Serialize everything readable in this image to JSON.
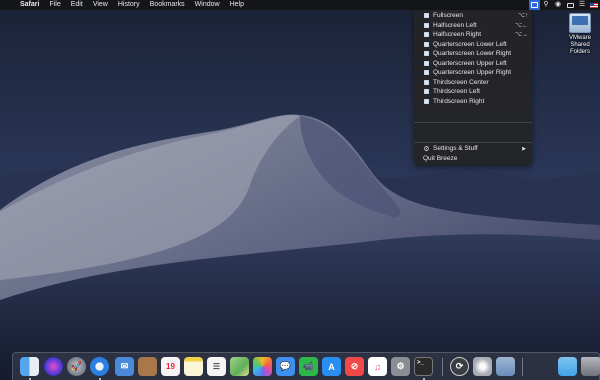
{
  "menubar": {
    "app_name": "Safari",
    "menus": [
      "File",
      "Edit",
      "View",
      "History",
      "Bookmarks",
      "Window",
      "Help"
    ]
  },
  "status_icons": [
    "breeze-icon",
    "search-icon",
    "siri-icon",
    "airplay-icon",
    "notification-center-icon",
    "flag-icon"
  ],
  "breeze_menu": {
    "items": [
      {
        "label": "Fullscreen",
        "shortcut": "⌥↑"
      },
      {
        "label": "Halfscreen Left",
        "shortcut": "⌥←"
      },
      {
        "label": "Halfscreen Right",
        "shortcut": "⌥→"
      },
      {
        "label": "Quarterscreen Lower Left",
        "shortcut": ""
      },
      {
        "label": "Quarterscreen Lower Right",
        "shortcut": ""
      },
      {
        "label": "Quarterscreen Upper Left",
        "shortcut": ""
      },
      {
        "label": "Quarterscreen Upper Right",
        "shortcut": ""
      },
      {
        "label": "Thirdscreen Center",
        "shortcut": ""
      },
      {
        "label": "Thirdscreen Left",
        "shortcut": ""
      },
      {
        "label": "Thirdscreen Right",
        "shortcut": ""
      }
    ],
    "settings_label": "Settings & Stuff",
    "quit_label": "Quit Breeze"
  },
  "desktop_icon": {
    "label_line1": "VMware Shared",
    "label_line2": "Folders"
  },
  "dock": {
    "apps": [
      {
        "name": "finder-icon",
        "color": "#3b8de0"
      },
      {
        "name": "siri-icon",
        "color": "#6a3fc8"
      },
      {
        "name": "launchpad-icon",
        "color": "#7d8790"
      },
      {
        "name": "safari-icon",
        "color": "#2a7fe0"
      },
      {
        "name": "mail-icon",
        "color": "#4a8ad8"
      },
      {
        "name": "contacts-icon",
        "color": "#a8784a"
      },
      {
        "name": "calendar-icon",
        "color": "#f4f4f4"
      },
      {
        "name": "notes-icon",
        "color": "#f3d14a"
      },
      {
        "name": "reminders-icon",
        "color": "#f5f5f5"
      },
      {
        "name": "maps-icon",
        "color": "#5fae5a"
      },
      {
        "name": "photos-icon",
        "color": "#f0f0f0"
      },
      {
        "name": "messages-icon",
        "color": "#3f8ff0"
      },
      {
        "name": "facetime-icon",
        "color": "#2fb84a"
      },
      {
        "name": "app-store-icon",
        "color": "#2a8ef0"
      },
      {
        "name": "news-icon",
        "color": "#f24848"
      },
      {
        "name": "music-icon",
        "color": "#f04a6a"
      },
      {
        "name": "system-preferences-icon",
        "color": "#8a8d94"
      },
      {
        "name": "terminal-icon",
        "color": "#2a2a2a"
      },
      {
        "name": "breeze-app-icon",
        "color": "#3a3d44"
      },
      {
        "name": "disk-utility-icon",
        "color": "#c9ccd2"
      },
      {
        "name": "preview-icon",
        "color": "#6a8cbc"
      },
      {
        "name": "downloads-folder-icon",
        "color": "#3fa3e6"
      },
      {
        "name": "trash-icon",
        "color": "#8d9097"
      }
    ],
    "calendar_day": "19",
    "terminal_prompt": ">_"
  }
}
